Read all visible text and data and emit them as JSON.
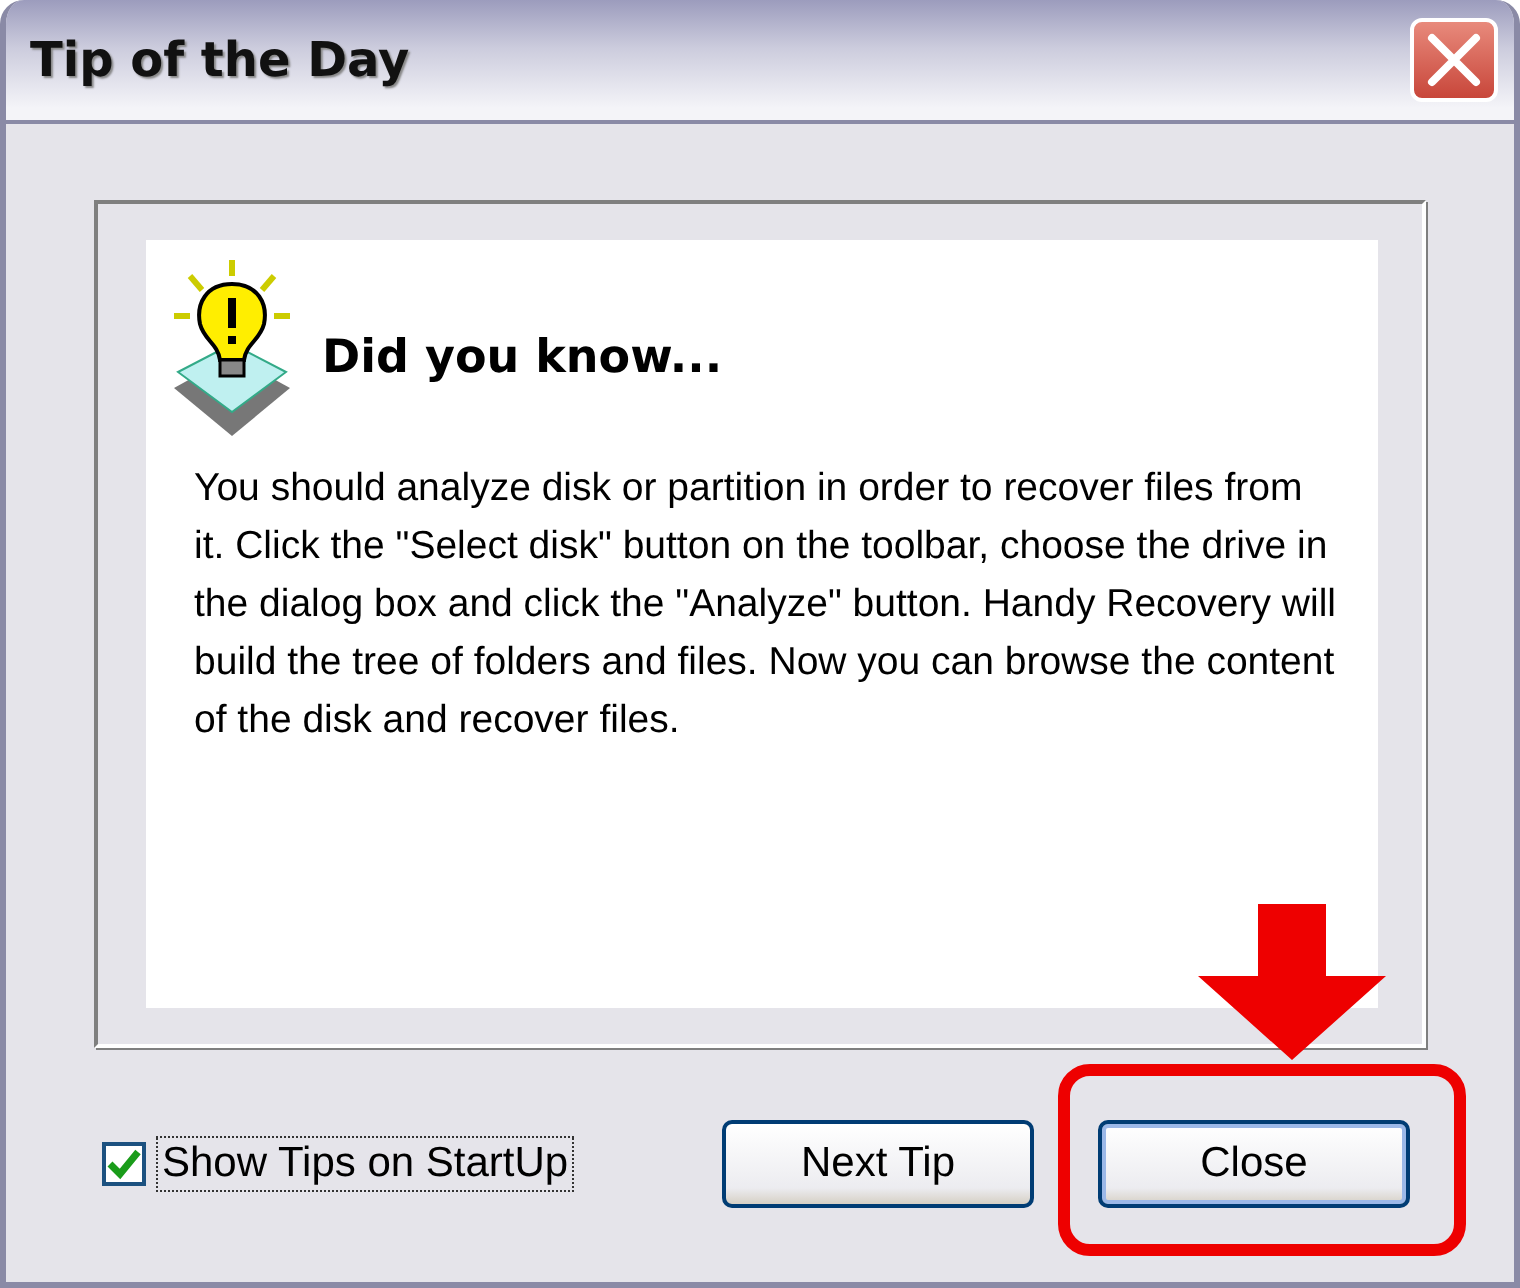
{
  "window": {
    "title": "Tip of the Day"
  },
  "tip": {
    "heading": "Did you know...",
    "text": "You should analyze disk or partition in order to recover files from it. Click the \"Select disk\" button on the toolbar, choose the drive in the dialog box and click the \"Analyze\" button. Handy Recovery will build the tree of folders and files. Now you can browse the content of the disk and recover files."
  },
  "show_tips": {
    "label": "Show Tips on StartUp",
    "checked": true
  },
  "buttons": [
    {
      "label": "Next Tip",
      "highlighted": false
    },
    {
      "label": "Close",
      "highlighted": true
    }
  ]
}
